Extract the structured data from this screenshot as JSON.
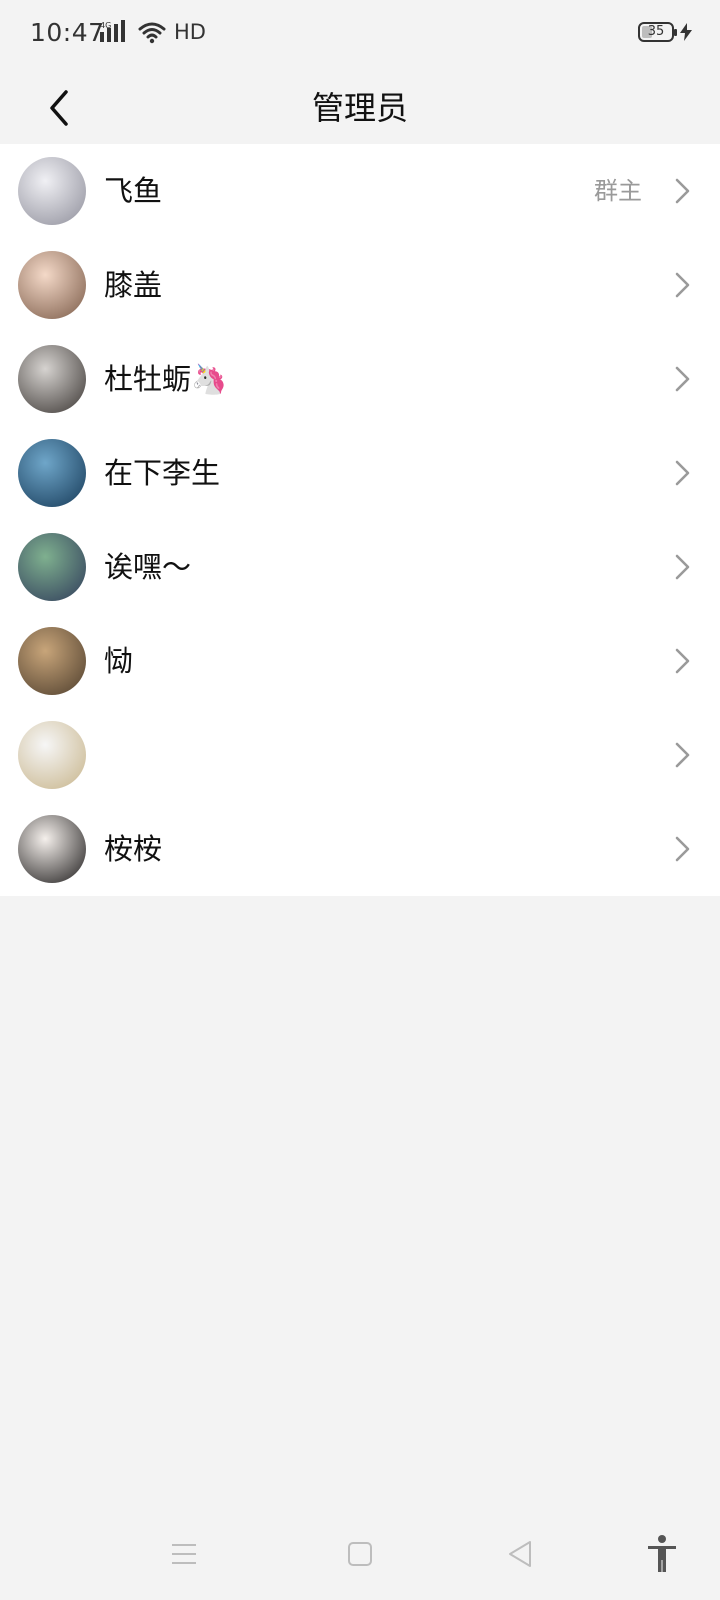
{
  "status_bar": {
    "time": "10:47",
    "network": "4G",
    "hd": "HD",
    "battery_level": "35",
    "battery_fraction": 0.35
  },
  "header": {
    "title": "管理员",
    "back_icon": "chevron-left-icon"
  },
  "members": [
    {
      "name": "飞鱼",
      "role": "群主",
      "avatar_colors": [
        "#f0f0f4",
        "#8e8e9a"
      ]
    },
    {
      "name": "膝盖",
      "role": "",
      "avatar_colors": [
        "#f4d9c8",
        "#7a5a47"
      ]
    },
    {
      "name": "杜牡蛎🦄",
      "role": "",
      "avatar_colors": [
        "#d6d3d0",
        "#3a3532"
      ]
    },
    {
      "name": "在下李生",
      "role": "",
      "avatar_colors": [
        "#6fa6c9",
        "#163a58"
      ]
    },
    {
      "name": "诶嘿～",
      "role": "",
      "avatar_colors": [
        "#7fb08f",
        "#2f3b5a"
      ]
    },
    {
      "name": "恸",
      "role": "",
      "avatar_colors": [
        "#c8a57a",
        "#4d3d2c"
      ]
    },
    {
      "name": "",
      "role": "",
      "avatar_colors": [
        "#f6f6f6",
        "#c7b48a"
      ]
    },
    {
      "name": "桉桉",
      "role": "",
      "avatar_colors": [
        "#f5f0ec",
        "#1d1b1b"
      ]
    }
  ],
  "nav_bar": {
    "icons": [
      "menu-icon",
      "home-square-icon",
      "back-triangle-icon",
      "accessibility-icon"
    ]
  },
  "colors": {
    "background": "#f3f3f3",
    "list_background": "#ffffff",
    "role_text": "#9a9a9a",
    "chevron": "#9a9a9a"
  }
}
